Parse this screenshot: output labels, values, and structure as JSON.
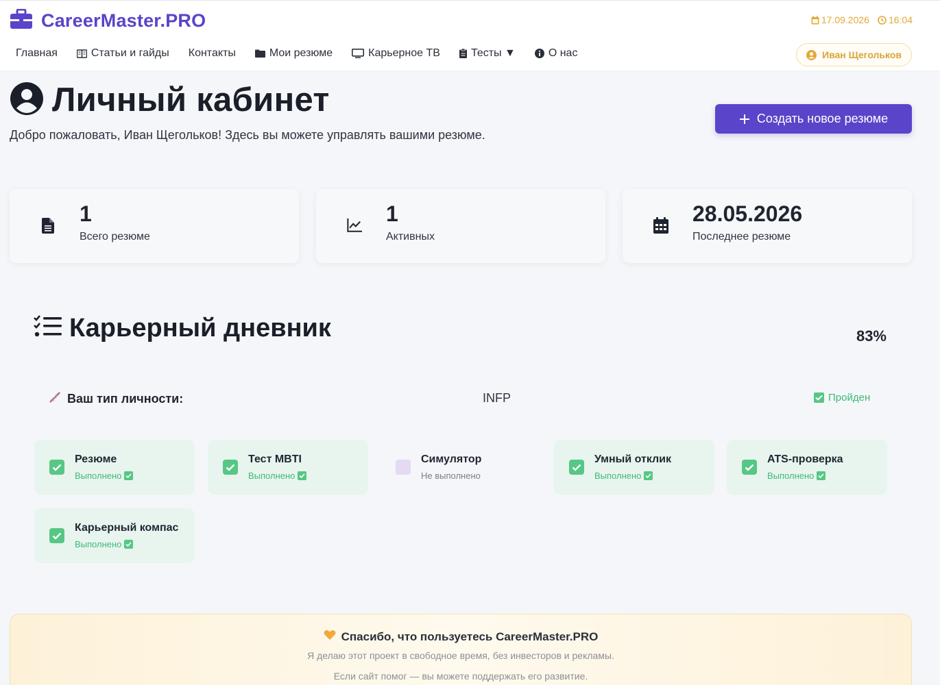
{
  "header": {
    "brand": "CareerMaster.PRO",
    "date": "17.09.2026",
    "time": "16:04",
    "user": "Иван Щегольков",
    "nav": [
      {
        "label": "Главная",
        "icon": ""
      },
      {
        "label": "Статьи и гайды",
        "icon": "book-icon"
      },
      {
        "label": "Контакты",
        "icon": ""
      },
      {
        "label": "Мои резюме",
        "icon": "folder-icon"
      },
      {
        "label": "Карьерное ТВ",
        "icon": "monitor-icon"
      },
      {
        "label": "Тесты ▼",
        "icon": "clipboard-icon"
      },
      {
        "label": "О нас",
        "icon": "info-icon"
      }
    ]
  },
  "page": {
    "title": "Личный кабинет",
    "subtitle": "Добро пожаловать, Иван Щегольков! Здесь вы можете управлять вашими резюме.",
    "create_button": "Создать новое резюме"
  },
  "stats": [
    {
      "value": "1",
      "label": "Всего резюме",
      "icon": "file-icon"
    },
    {
      "value": "1",
      "label": "Активных",
      "icon": "chart-line-icon"
    },
    {
      "value": "28.05.2026",
      "label": "Последнее резюме",
      "icon": "calendar-icon"
    }
  ],
  "diary": {
    "title": "Карьерный дневник",
    "percent": "83%",
    "personality_label": "Ваш тип личности:",
    "personality_value": "INFP",
    "personality_status": "Пройден",
    "tasks": [
      {
        "name": "Резюме",
        "status": "Выполнено",
        "done": true
      },
      {
        "name": "Тест MBTI",
        "status": "Выполнено",
        "done": true
      },
      {
        "name": "Симулятор",
        "status": "Не выполнено",
        "done": false
      },
      {
        "name": "Умный отклик",
        "status": "Выполнено",
        "done": true
      },
      {
        "name": "ATS-проверка",
        "status": "Выполнено",
        "done": true
      },
      {
        "name": "Карьерный компас",
        "status": "Выполнено",
        "done": true
      }
    ]
  },
  "thanks": {
    "title": "Спасибо, что пользуетесь CareerMaster.PRO",
    "line1": "Я делаю этот проект в свободное время, без инвесторов и рекламы.",
    "line2": "Если сайт помог — вы можете поддержать его развитие."
  },
  "colors": {
    "accent": "#5a44c9",
    "success": "#56c784",
    "warning": "#e0a93a"
  }
}
